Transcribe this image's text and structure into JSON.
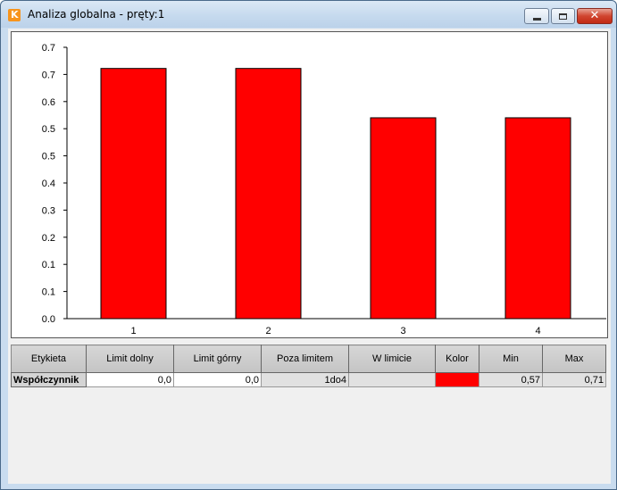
{
  "window": {
    "title": "Analiza globalna - pręty:1",
    "icon": "app-logo-icon",
    "app_icon_letter": "K",
    "controls": [
      "minimize-icon",
      "maximize-icon",
      "close-icon"
    ]
  },
  "chart_data": {
    "type": "bar",
    "categories": [
      "1",
      "2",
      "3",
      "4"
    ],
    "values": [
      0.71,
      0.71,
      0.57,
      0.57
    ],
    "ytick_labels": [
      "0.0",
      "0.1",
      "0.1",
      "0.2",
      "0.3",
      "0.4",
      "0.5",
      "0.5",
      "0.6",
      "0.7",
      "0.7"
    ],
    "ylim": [
      0,
      0.77
    ],
    "bar_color": "#ff0000",
    "title": "",
    "xlabel": "",
    "ylabel": "",
    "grid": false
  },
  "table": {
    "headers": [
      "Etykieta",
      "Limit dolny",
      "Limit górny",
      "Poza limitem",
      "W limicie",
      "Kolor",
      "Min",
      "Max"
    ],
    "rows": [
      {
        "label": "Współczynnik",
        "limit_dolny": "0,0",
        "limit_gorny": "0,0",
        "poza_limitem": "1do4",
        "w_limicie": "",
        "kolor": "#ff0000",
        "min": "0,57",
        "max": "0,71"
      }
    ]
  }
}
